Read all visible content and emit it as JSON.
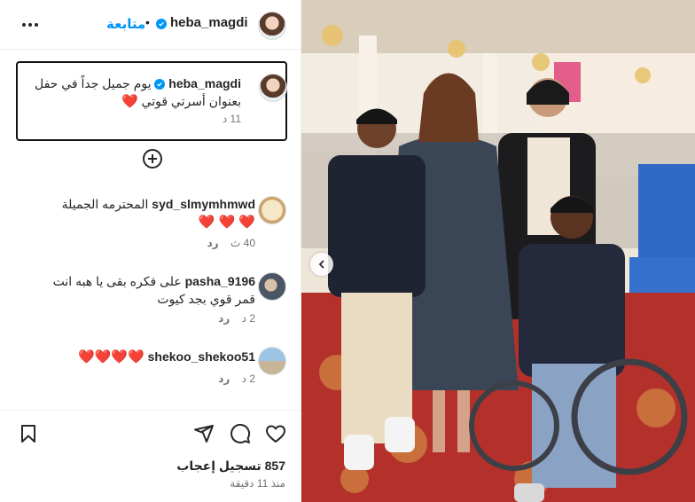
{
  "header": {
    "username": "heba_magdi",
    "follow_label": "متابعة",
    "separator": "•"
  },
  "caption": {
    "username": "heba_magdi",
    "text": "يوم جميل جداً في حفل بعنوان أسرتي قوتي",
    "heart": "❤️",
    "time": "11 د"
  },
  "comments": [
    {
      "username": "syd_slmymhmwd",
      "text": "المحترمه الجميلة",
      "hearts": "❤️ ❤️ ❤️",
      "time": "40 ث",
      "reply": "رد"
    },
    {
      "username": "pasha_9196",
      "text": "على فكره بقى يا هبه انت قمر قوي بجد كيوت",
      "time": "2 د",
      "reply": "رد"
    },
    {
      "username": "shekoo_shekoo51",
      "text": "",
      "hearts": "❤️❤️❤️❤️",
      "time": "2 د",
      "reply": "رد"
    }
  ],
  "footer": {
    "likes": "857 تسجيل إعجاب",
    "time_ago": "منذ 11 دقيقة"
  },
  "icons": [
    "more-icon",
    "verified-icon",
    "add-comment-icon",
    "bookmark-icon",
    "share-icon",
    "comment-icon",
    "like-icon",
    "chevron-left-icon"
  ],
  "colors": {
    "link": "#0095f6",
    "heart": "#e11d48",
    "muted": "#737373"
  }
}
